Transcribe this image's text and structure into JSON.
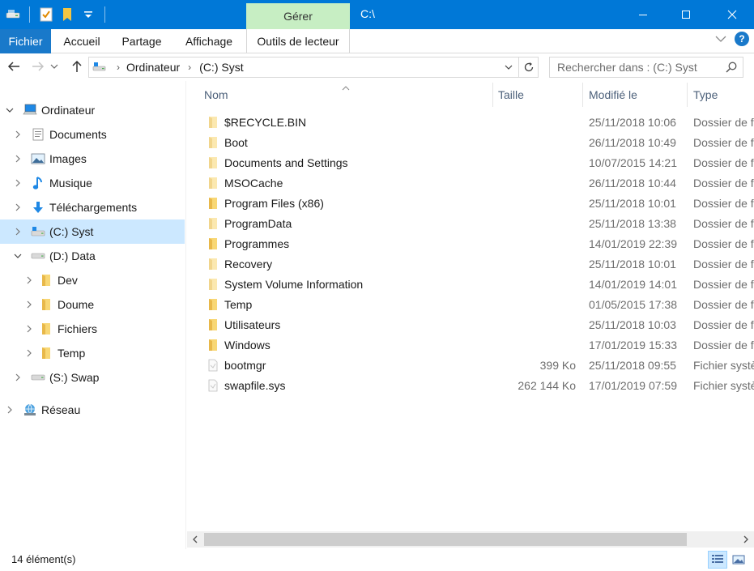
{
  "window": {
    "title": "C:\\",
    "contextual_tab": "Gérer",
    "accent": "#0078d7"
  },
  "ribbon": {
    "tabs": [
      "Fichier",
      "Accueil",
      "Partage",
      "Affichage",
      "Outils de lecteur"
    ]
  },
  "address": {
    "crumbs": [
      "Ordinateur",
      "(C:) Syst"
    ]
  },
  "search": {
    "placeholder": "Rechercher dans : (C:) Syst"
  },
  "nav": {
    "items": [
      {
        "label": "Ordinateur",
        "icon": "computer-icon",
        "expanded": true
      },
      {
        "label": "Documents",
        "icon": "documents-icon"
      },
      {
        "label": "Images",
        "icon": "pictures-icon"
      },
      {
        "label": "Musique",
        "icon": "music-icon"
      },
      {
        "label": "Téléchargements",
        "icon": "downloads-icon"
      },
      {
        "label": "(C:) Syst",
        "icon": "system-drive-icon",
        "selected": true
      },
      {
        "label": "(D:) Data",
        "icon": "drive-icon",
        "expanded": true
      },
      {
        "label": "Dev",
        "icon": "folder-icon"
      },
      {
        "label": "Doume",
        "icon": "folder-icon"
      },
      {
        "label": "Fichiers",
        "icon": "folder-icon"
      },
      {
        "label": "Temp",
        "icon": "folder-icon"
      },
      {
        "label": "(S:) Swap",
        "icon": "drive-icon"
      },
      {
        "label": "Réseau",
        "icon": "network-icon"
      }
    ]
  },
  "columns": [
    "Nom",
    "Taille",
    "Modifié le",
    "Type"
  ],
  "files": [
    {
      "name": "$RECYCLE.BIN",
      "size": "",
      "modified": "25/11/2018 10:06",
      "type": "Dossier de fi",
      "kind": "folder-faded"
    },
    {
      "name": "Boot",
      "size": "",
      "modified": "26/11/2018 10:49",
      "type": "Dossier de fi",
      "kind": "folder-faded"
    },
    {
      "name": "Documents and Settings",
      "size": "",
      "modified": "10/07/2015 14:21",
      "type": "Dossier de fi",
      "kind": "folder-faded"
    },
    {
      "name": "MSOCache",
      "size": "",
      "modified": "26/11/2018 10:44",
      "type": "Dossier de fi",
      "kind": "folder-faded"
    },
    {
      "name": "Program Files (x86)",
      "size": "",
      "modified": "25/11/2018 10:01",
      "type": "Dossier de fi",
      "kind": "folder"
    },
    {
      "name": "ProgramData",
      "size": "",
      "modified": "25/11/2018 13:38",
      "type": "Dossier de fi",
      "kind": "folder-faded"
    },
    {
      "name": "Programmes",
      "size": "",
      "modified": "14/01/2019 22:39",
      "type": "Dossier de fi",
      "kind": "folder"
    },
    {
      "name": "Recovery",
      "size": "",
      "modified": "25/11/2018 10:01",
      "type": "Dossier de fi",
      "kind": "folder-faded"
    },
    {
      "name": "System Volume Information",
      "size": "",
      "modified": "14/01/2019 14:01",
      "type": "Dossier de fi",
      "kind": "folder-faded"
    },
    {
      "name": "Temp",
      "size": "",
      "modified": "01/05/2015 17:38",
      "type": "Dossier de fi",
      "kind": "folder"
    },
    {
      "name": "Utilisateurs",
      "size": "",
      "modified": "25/11/2018 10:03",
      "type": "Dossier de fi",
      "kind": "folder"
    },
    {
      "name": "Windows",
      "size": "",
      "modified": "17/01/2019 15:33",
      "type": "Dossier de fi",
      "kind": "folder"
    },
    {
      "name": "bootmgr",
      "size": "399 Ko",
      "modified": "25/11/2018 09:55",
      "type": "Fichier systè",
      "kind": "file"
    },
    {
      "name": "swapfile.sys",
      "size": "262 144 Ko",
      "modified": "17/01/2019 07:59",
      "type": "Fichier systè",
      "kind": "file"
    }
  ],
  "status": {
    "count": "14 élément(s)"
  }
}
